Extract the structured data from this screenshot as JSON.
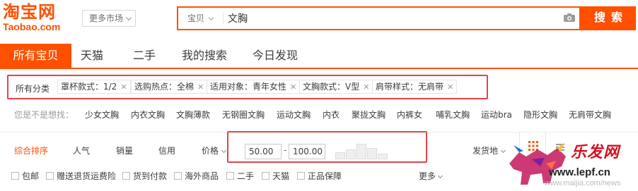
{
  "logo": {
    "cn": "淘宝网",
    "en": "Taobao.com"
  },
  "market_btn": "更多市场",
  "search": {
    "type": "宝贝",
    "value": "文胸",
    "button": "搜索"
  },
  "tabs": [
    "所有宝贝",
    "天猫",
    "二手",
    "我的搜索",
    "今日发现"
  ],
  "crumbs": {
    "all": "所有分类",
    "tags": [
      "罩杯款式：1/2",
      "选购热点：全棉",
      "适用对象：青年女性",
      "文胸款式：V型",
      "肩带样式：无肩带"
    ]
  },
  "suggest": {
    "label": "您是不是想找：",
    "items": [
      "少女文胸",
      "内衣文胸",
      "文胸薄款",
      "无钢圈文胸",
      "运动文胸",
      "内衣",
      "聚拢文胸",
      "内裤女",
      "哺乳文胸",
      "运动bra",
      "隐形文胸",
      "无肩带文胸"
    ]
  },
  "sort": {
    "items": [
      "综合排序",
      "人气",
      "销量",
      "信用",
      "价格"
    ],
    "price_min": "50.00",
    "price_max": "100.00",
    "dash": "-",
    "ship_from": "发货地"
  },
  "options": [
    "包邮",
    "赠送退货运费险",
    "货到付款",
    "海外商品",
    "二手",
    "天猫",
    "正品保障"
  ],
  "more": "更多",
  "watermark": {
    "title": "乐发网",
    "url": "www.lepf.cn",
    "url2": "www.maijia.com/news"
  },
  "colors": {
    "brand": "#ff5000",
    "highlight_box": "#e34347"
  },
  "icons": [
    "camera-icon",
    "grid-icon",
    "list-icon",
    "close-icon",
    "chevron-down-icon"
  ]
}
